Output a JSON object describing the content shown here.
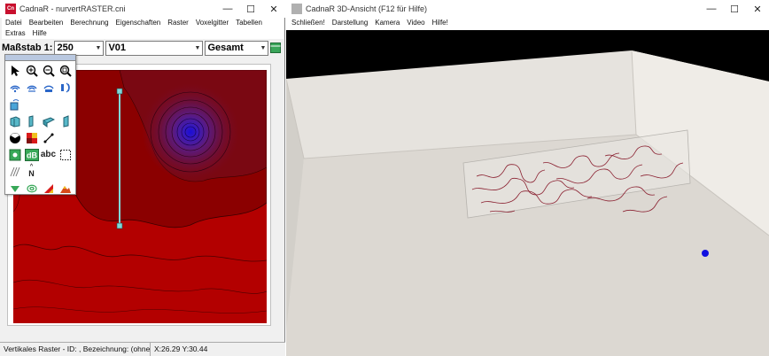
{
  "left_window": {
    "title": "CadnaR - nurvertRASTER.cni",
    "menu": [
      "Datei",
      "Bearbeiten",
      "Berechnung",
      "Eigenschaften",
      "Raster",
      "Voxelgitter",
      "Tabellen",
      "Extras",
      "Hilfe"
    ],
    "toolbar": {
      "scale_label": "Maßstab 1:",
      "scale_value": "250",
      "variant_value": "V01",
      "level_value": "Gesamt"
    },
    "palette": {
      "text_tool": "abc",
      "north_label": "N",
      "db_label": "dB"
    },
    "status": {
      "info": "Vertikales Raster - ID: , Bezeichnung: (ohne",
      "coords": "X:26.29 Y:30.44"
    }
  },
  "right_window": {
    "title": "CadnaR 3D-Ansicht (F12 für Hilfe)",
    "menu": [
      "Schließen!",
      "Darstellung",
      "Kamera",
      "Video",
      "Hilfe!"
    ]
  },
  "window_controls": {
    "minimize": "—",
    "maximize": "☐",
    "close": "✕"
  },
  "colors": {
    "map_dark": "#8b0000",
    "map_mid": "#b30000",
    "source_center": "#1a0dd6",
    "floor": "#dcd8d2",
    "wall": "#ebe8e3",
    "sky": "#000000",
    "contour": "#8a2030"
  }
}
